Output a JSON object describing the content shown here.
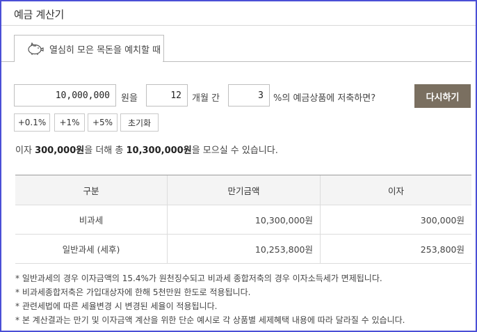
{
  "header": {
    "title": "예금 계산기"
  },
  "tab": {
    "label": "열심히 모은 목돈을 예치할 때",
    "icon": "piggy-bank-icon"
  },
  "form": {
    "amount_value": "10,000,000",
    "amount_unit": "원을",
    "months_value": "12",
    "months_unit": "개월 간",
    "rate_value": "3",
    "rate_unit": "%의 예금상품에 저축하면?",
    "redo_button": "다시하기",
    "chips": [
      "+0.1%",
      "+1%",
      "+5%",
      "초기화"
    ]
  },
  "summary": {
    "prefix": "이자 ",
    "interest": "300,000원",
    "middle": "을 더해 총 ",
    "total": "10,300,000원",
    "suffix": "을 모으실 수 있습니다."
  },
  "table": {
    "headers": [
      "구분",
      "만기금액",
      "이자"
    ],
    "rows": [
      [
        "비과세",
        "10,300,000원",
        "300,000원"
      ],
      [
        "일반과세 (세후)",
        "10,253,800원",
        "253,800원"
      ]
    ]
  },
  "notes": [
    "* 일반과세의 경우 이자금액의 15.4%가 원천징수되고 비과세 종합저축의 경우 이자소득세가 면제됩니다.",
    "* 비과세종합저축은 가입대상자에 한해 5천만원 한도로 적용됩니다.",
    "* 관련세법에 따른 세율변경 시 변경된 세율이 적용됩니다.",
    "* 본 계산결과는 만기 및 이자금액 계산을 위한 단순 예시로 각 상품별 세제혜택 내용에 따라 달라질 수 있습니다."
  ],
  "colors": {
    "frame": "#4a4fd6",
    "button": "#7a6f60"
  }
}
